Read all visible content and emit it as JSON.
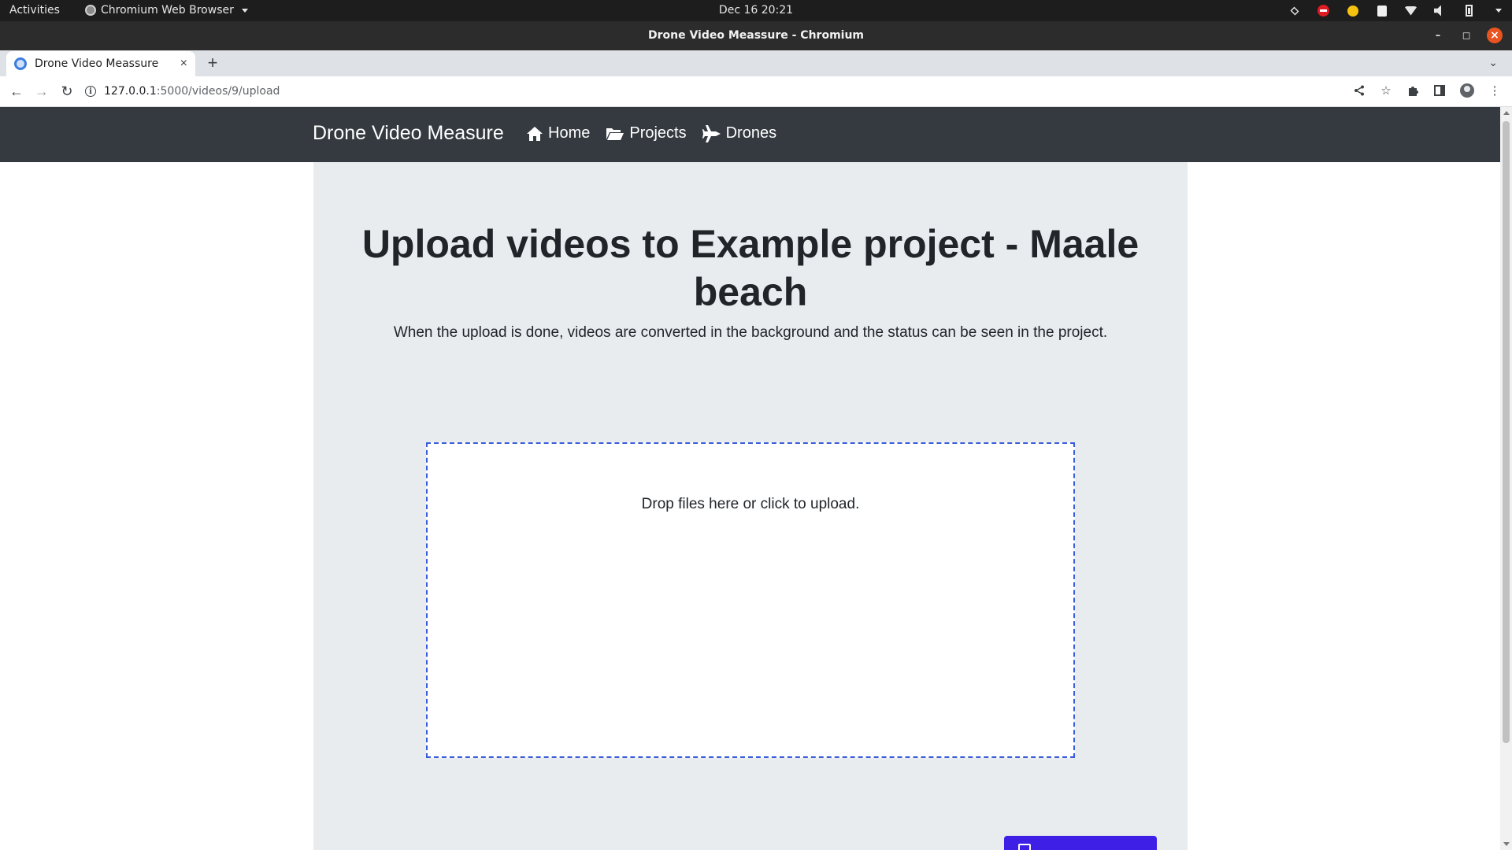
{
  "os": {
    "activities": "Activities",
    "app_name": "Chromium Web Browser",
    "clock": "Dec 16  20:21"
  },
  "window": {
    "title": "Drone Video Meassure - Chromium"
  },
  "browser": {
    "tab_title": "Drone Video Meassure",
    "url_host": "127.0.0.1",
    "url_path": ":5000/videos/9/upload"
  },
  "page": {
    "brand": "Drone Video Measure",
    "nav": [
      {
        "label": "Home",
        "icon": "home-icon"
      },
      {
        "label": "Projects",
        "icon": "folder-open-icon"
      },
      {
        "label": "Drones",
        "icon": "plane-icon"
      }
    ],
    "heading": "Upload videos to Example project - Maale beach",
    "lead": "When the upload is done, videos are converted in the background and the status can be seen in the project.",
    "dropzone_message": "Drop files here or click to upload."
  },
  "colors": {
    "navbar": "#343a40",
    "jumbotron": "#e9ecef",
    "dropzone_border": "#3a5dd9",
    "primary_button": "#3d1fe6",
    "window_close": "#e95420"
  }
}
